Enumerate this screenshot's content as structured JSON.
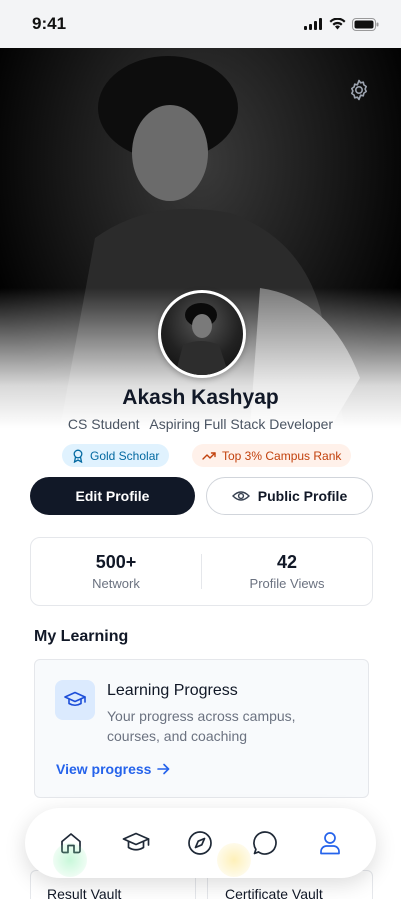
{
  "status_bar": {
    "time": "9:41"
  },
  "profile": {
    "name": "Akash Kashyap",
    "role": "CS Student",
    "tagline": "Aspiring Full Stack Developer",
    "badges": [
      {
        "label": "Gold Scholar",
        "icon": "award-icon",
        "color": "#0369a1"
      },
      {
        "label": "Top 3% Campus Rank",
        "icon": "trending-up-icon",
        "color": "#c2410c"
      }
    ],
    "actions": {
      "edit": "Edit Profile",
      "public": "Public Profile"
    },
    "stats": [
      {
        "value": "500+",
        "label": "Network"
      },
      {
        "value": "42",
        "label": "Profile Views"
      }
    ]
  },
  "learning": {
    "section_title": "My Learning",
    "card_title": "Learning Progress",
    "card_desc": "Your progress across campus, courses, and coaching",
    "link": "View progress",
    "icon": "graduation-cap-icon"
  },
  "vaults": [
    {
      "label": "Result Vault"
    },
    {
      "label": "Certificate Vault"
    }
  ],
  "nav": [
    {
      "icon": "home-icon",
      "active": false
    },
    {
      "icon": "graduation-cap-icon",
      "active": false
    },
    {
      "icon": "compass-icon",
      "active": false
    },
    {
      "icon": "chat-icon",
      "active": false
    },
    {
      "icon": "user-icon",
      "active": true
    }
  ],
  "colors": {
    "accent": "#2563eb",
    "dark_button": "#111827"
  }
}
